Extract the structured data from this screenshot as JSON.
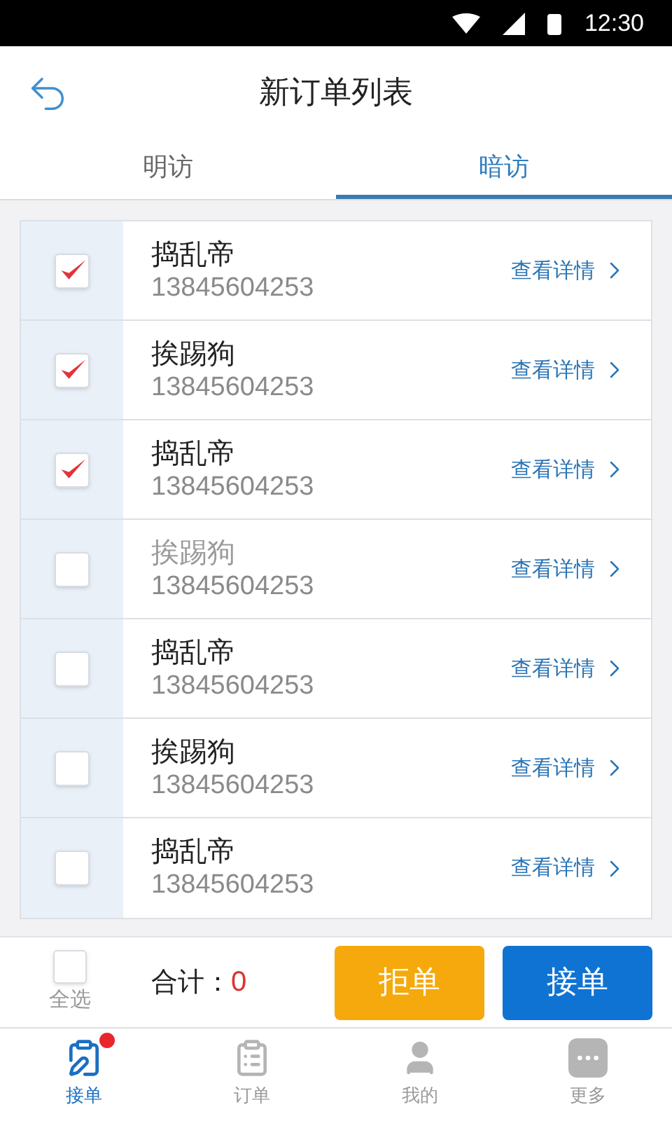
{
  "status_bar": {
    "time": "12:30"
  },
  "header": {
    "title": "新订单列表"
  },
  "tabs": [
    {
      "label": "明访",
      "selected": false
    },
    {
      "label": "暗访",
      "selected": true
    }
  ],
  "orders": [
    {
      "name": "捣乱帝",
      "phone": "13845604253",
      "checked": true,
      "disabled": false,
      "link": "查看详情"
    },
    {
      "name": "挨踢狗",
      "phone": "13845604253",
      "checked": true,
      "disabled": false,
      "link": "查看详情"
    },
    {
      "name": "捣乱帝",
      "phone": "13845604253",
      "checked": true,
      "disabled": false,
      "link": "查看详情"
    },
    {
      "name": "挨踢狗",
      "phone": "13845604253",
      "checked": false,
      "disabled": true,
      "link": "查看详情"
    },
    {
      "name": "捣乱帝",
      "phone": "13845604253",
      "checked": false,
      "disabled": false,
      "link": "查看详情"
    },
    {
      "name": "挨踢狗",
      "phone": "13845604253",
      "checked": false,
      "disabled": false,
      "link": "查看详情"
    },
    {
      "name": "捣乱帝",
      "phone": "13845604253",
      "checked": false,
      "disabled": false,
      "link": "查看详情"
    }
  ],
  "action_bar": {
    "select_all": {
      "label": "全选",
      "checked": false
    },
    "total_label": "合计：",
    "total": "0",
    "buttons": [
      {
        "label": "拒单",
        "kind": "reject"
      },
      {
        "label": "接单",
        "kind": "accept"
      }
    ]
  },
  "nav": [
    {
      "label": "接单",
      "kind": "accept",
      "selected": true,
      "badge": true
    },
    {
      "label": "订单",
      "kind": "orders",
      "selected": false,
      "badge": false
    },
    {
      "label": "我的",
      "kind": "me",
      "selected": false,
      "badge": false
    },
    {
      "label": "更多",
      "kind": "more",
      "selected": false,
      "badge": false
    }
  ]
}
